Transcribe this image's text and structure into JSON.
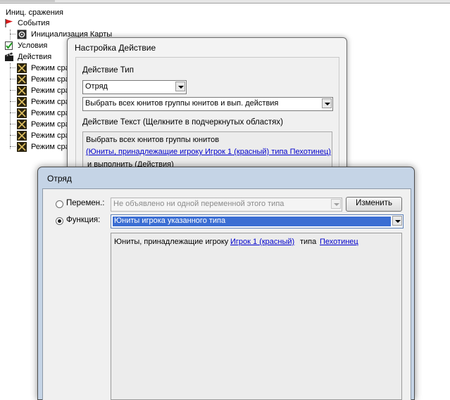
{
  "tree": {
    "root": "Иниц. сражения",
    "events": "События",
    "init_map": "Инициализация Карты",
    "conditions": "Условия",
    "actions": "Действия",
    "action_items": [
      "Режим сра",
      "Режим сра",
      "Режим сра",
      "Режим сра",
      "Режим сра",
      "Режим сра",
      "Режим сра",
      "Режим сра"
    ]
  },
  "action_dialog": {
    "title": "Настройка Действие",
    "type_label": "Действие Тип",
    "type_value": "Отряд",
    "action_value": "Выбрать всех юнитов группы юнитов и вып. действия",
    "text_label": "Действие Текст (Щелкните в подчеркнутых областях)",
    "text_line1": "Выбрать всех юнитов группы юнитов",
    "text_link": "(Юниты, принадлежащие игроку Игрок 1 (красный) типа Пехотинец)",
    "text_line3": "и выполнить (Действия)"
  },
  "squad_dialog": {
    "title": "Отряд",
    "variable_label": "Перемен.:",
    "variable_value": "Не объявлено ни одной переменной этого типа",
    "change_button": "Изменить",
    "function_label": "Функция:",
    "function_value": "Юниты игрока указанного типа",
    "editor_text1": "Юниты, принадлежащие игроку",
    "editor_link1": "Игрок 1 (красный)",
    "editor_text2": "типа",
    "editor_link2": "Пехотинец"
  },
  "colors": {
    "link": "#0000cc",
    "selection": "#3b6ed3",
    "window_frame": "#c5d4e6"
  }
}
